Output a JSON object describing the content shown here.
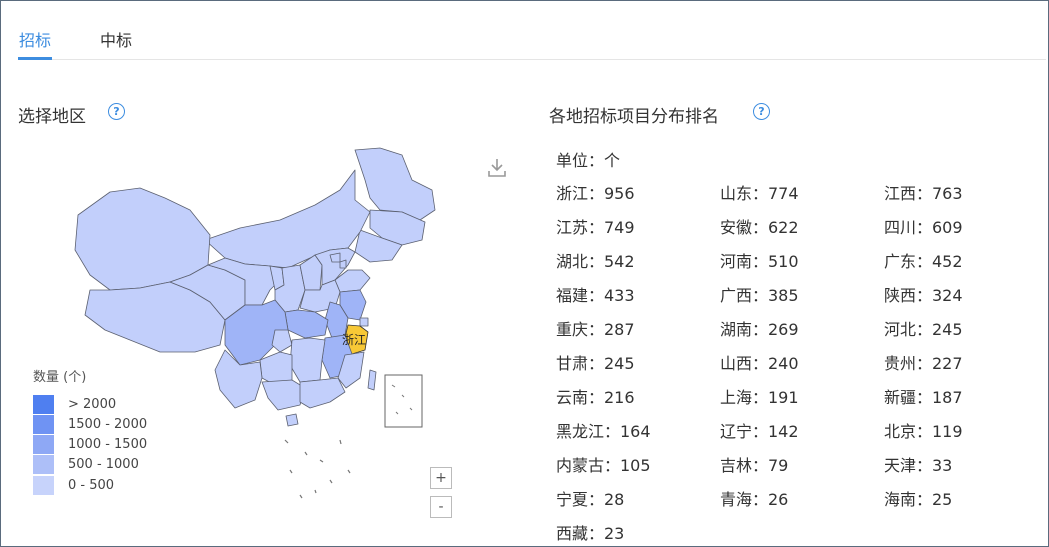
{
  "tabs": [
    {
      "label": "招标",
      "active": true
    },
    {
      "label": "中标",
      "active": false
    }
  ],
  "left_panel": {
    "title": "选择地区",
    "help_icon": "?",
    "map": {
      "highlighted_region_label": "浙江",
      "legend_title": "数量 (个)",
      "legend": [
        {
          "label": "> 2000",
          "color": "#4f7ff0"
        },
        {
          "label": "1500 - 2000",
          "color": "#6f93f3"
        },
        {
          "label": "1000 - 1500",
          "color": "#8ea8f5"
        },
        {
          "label": "500 - 1000",
          "color": "#adbff8"
        },
        {
          "label": "0 - 500",
          "color": "#c7d3fb"
        }
      ],
      "zoom_in": "+",
      "zoom_out": "-",
      "download_icon": "download-icon"
    }
  },
  "right_panel": {
    "title": "各地招标项目分布排名",
    "help_icon": "?",
    "unit": "单位：个",
    "rankings": [
      [
        "浙江：956",
        "山东：774",
        "江西：763"
      ],
      [
        "江苏：749",
        "安徽：622",
        "四川：609"
      ],
      [
        "湖北：542",
        "河南：510",
        "广东：452"
      ],
      [
        "福建：433",
        "广西：385",
        "陕西：324"
      ],
      [
        "重庆：287",
        "湖南：269",
        "河北：245"
      ],
      [
        "甘肃：245",
        "山西：240",
        "贵州：227"
      ],
      [
        "云南：216",
        "上海：191",
        "新疆：187"
      ],
      [
        "黑龙江：164",
        "辽宁：142",
        "北京：119"
      ],
      [
        "内蒙古：105",
        "吉林：79",
        "天津：33"
      ],
      [
        "宁夏：28",
        "青海：26",
        "海南：25"
      ],
      [
        "西藏：23"
      ]
    ]
  },
  "colors": {
    "accent": "#3d8de0",
    "highlight": "#f7c836",
    "map_light": "#c2cffb",
    "map_mid": "#9fb4f7"
  }
}
